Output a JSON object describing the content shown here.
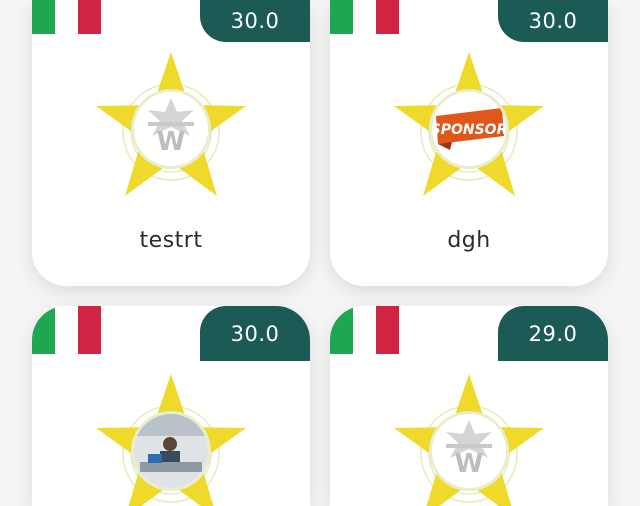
{
  "cards": [
    {
      "score": "30.0",
      "name": "testrt",
      "logo": "w-logo-icon"
    },
    {
      "score": "30.0",
      "name": "dgh",
      "logo": "sponsor-logo-icon",
      "logo_text": "SPONSOR"
    },
    {
      "score": "30.0",
      "name": "",
      "logo": "photo-thumbnail"
    },
    {
      "score": "29.0",
      "name": "",
      "logo": "w-logo-icon"
    }
  ],
  "colors": {
    "score_bg": "#1c5b55",
    "star": "#efd92a",
    "flag_green": "#1ea650",
    "flag_red": "#d12443"
  }
}
